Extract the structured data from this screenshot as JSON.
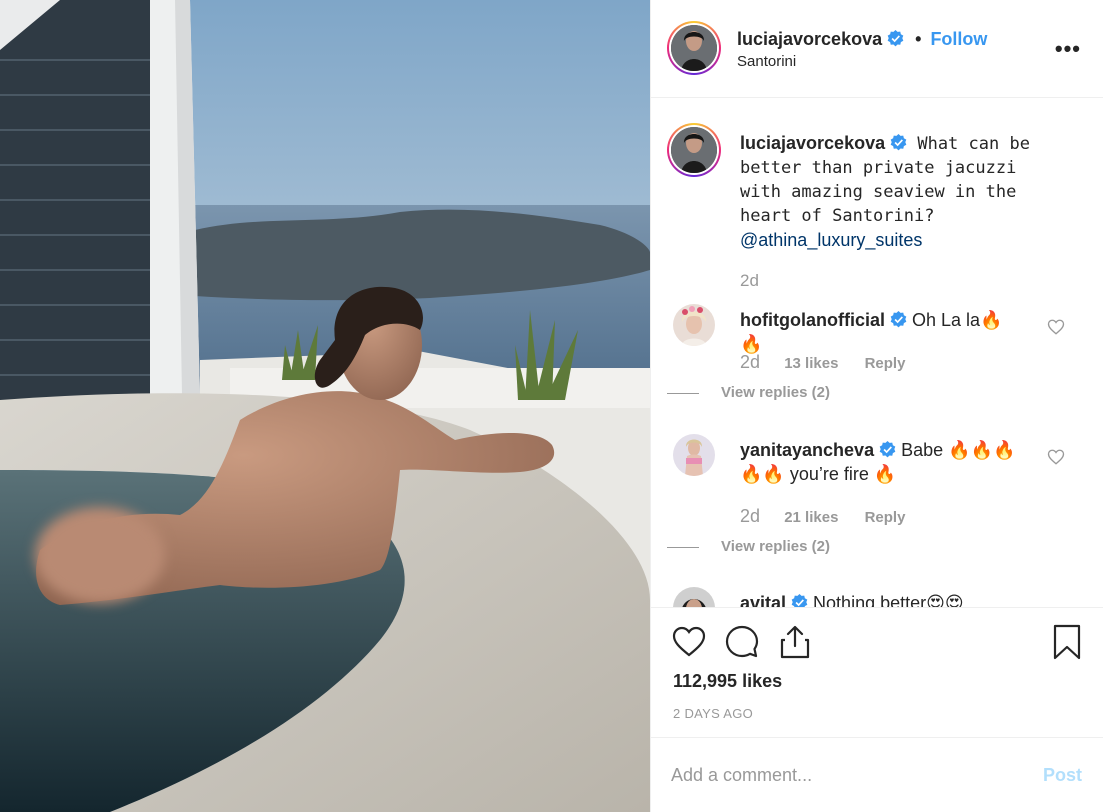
{
  "post": {
    "username": "luciajavorcekova",
    "location": "Santorini",
    "follow_label": "Follow",
    "separator": "•",
    "more_label": "•••"
  },
  "caption": {
    "username": "luciajavorcekova",
    "text": "What can be better than private jacuzzi with amazing seaview in the heart of Santorini?",
    "mention": "@athina_luxury_suites",
    "time": "2d"
  },
  "comments": [
    {
      "username": "hofitgolanofficial",
      "text": "Oh La la🔥🔥",
      "time": "2d",
      "likes": "13 likes",
      "reply_label": "Reply",
      "view_replies": "View replies (2)"
    },
    {
      "username": "yanitayancheva",
      "text": "Babe 🔥🔥🔥 🔥🔥 you’re fire 🔥",
      "time": "2d",
      "likes": "21 likes",
      "reply_label": "Reply",
      "view_replies": "View replies (2)"
    },
    {
      "username": "avital",
      "text": "Nothing better😍😍"
    }
  ],
  "actions": {
    "likes_count": "112,995 likes",
    "posted_ago": "2 DAYS AGO"
  },
  "add_comment": {
    "placeholder": "Add a comment...",
    "post_label": "Post"
  },
  "colors": {
    "link_blue": "#3897f0",
    "mention_blue": "#003569",
    "muted": "#999999",
    "verified_blue": "#3897f0",
    "post_disabled": "#b2dffc"
  },
  "icons": [
    "verified-badge-icon",
    "more-options-icon",
    "heart-icon",
    "comment-icon",
    "share-icon",
    "bookmark-icon"
  ]
}
